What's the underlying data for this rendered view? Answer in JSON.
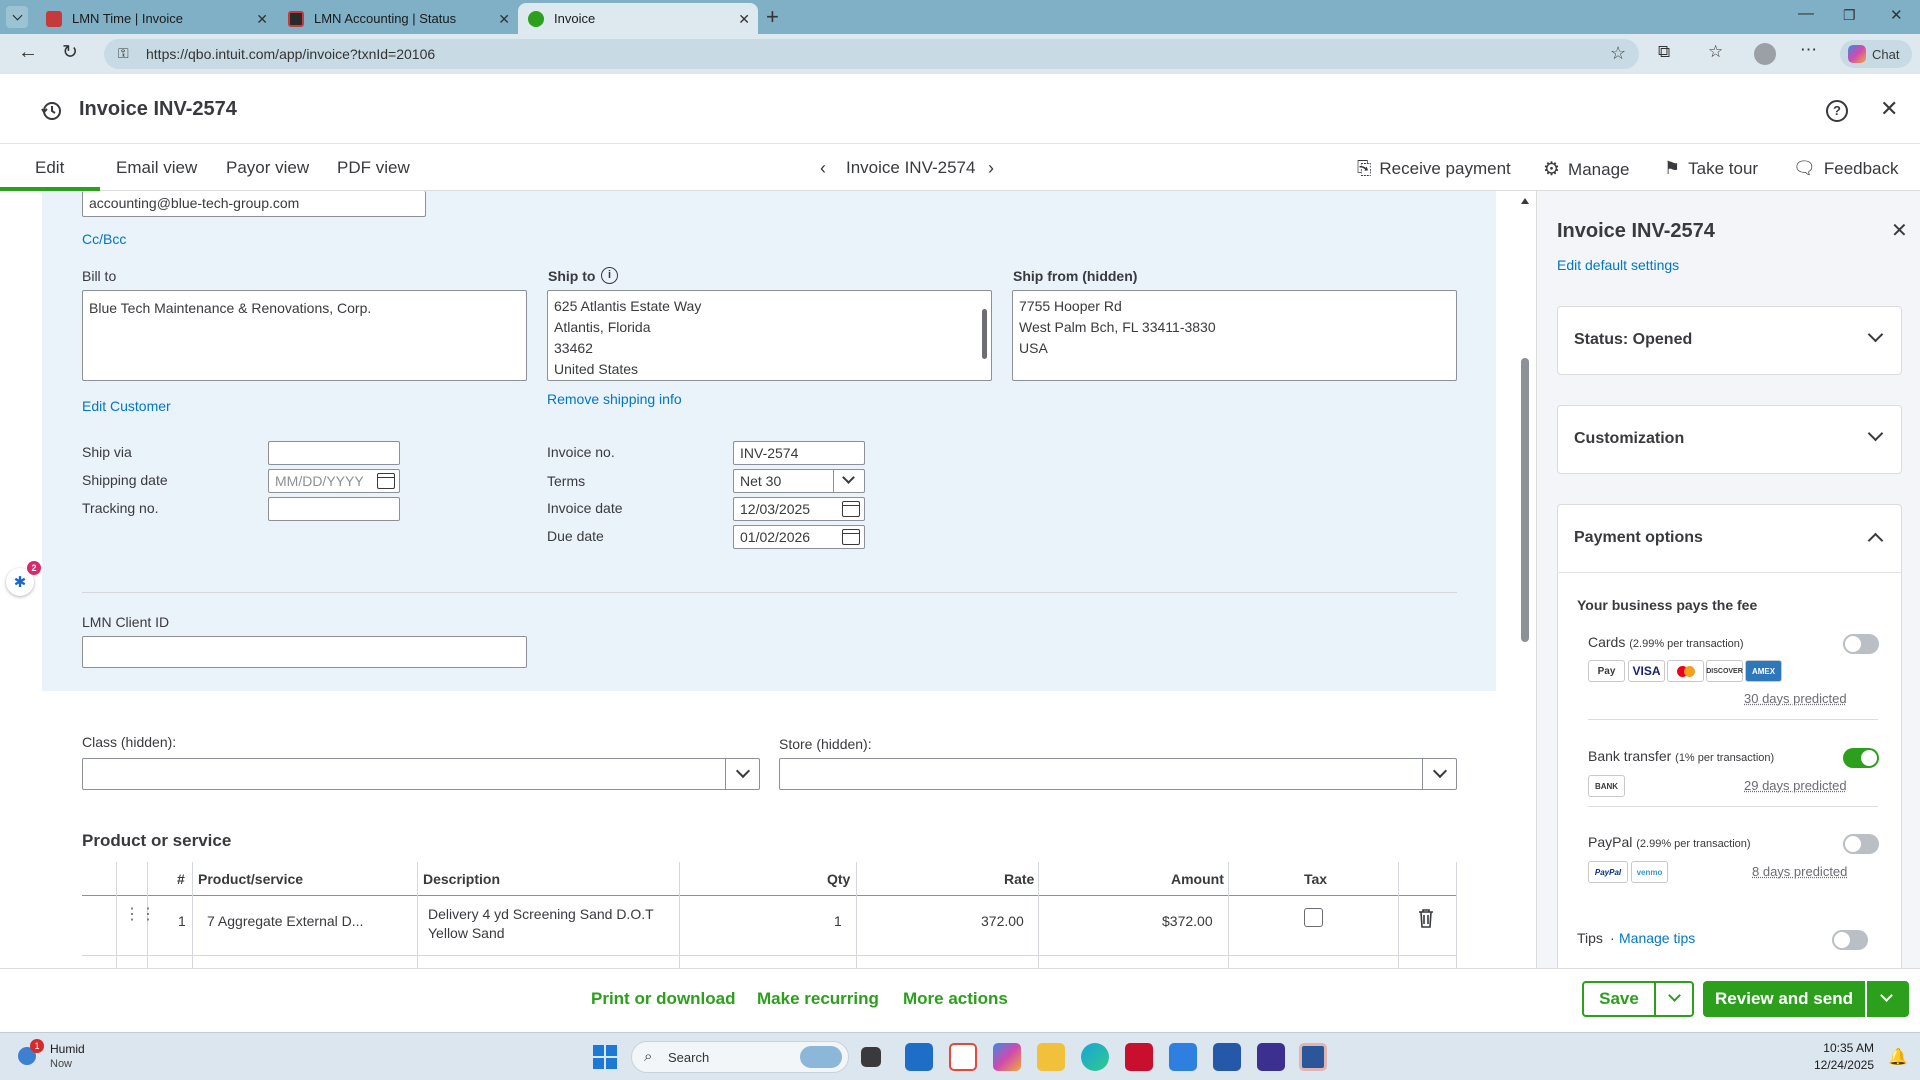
{
  "browser": {
    "tabs": [
      {
        "label": "LMN Time | Invoice",
        "active": false
      },
      {
        "label": "LMN Accounting | Status",
        "active": false
      },
      {
        "label": "Invoice",
        "active": true
      }
    ],
    "url": "https://qbo.intuit.com/app/invoice?txnId=20106",
    "chat_label": "Chat"
  },
  "header": {
    "title": "Invoice INV-2574"
  },
  "nav": {
    "tabs": [
      "Edit",
      "Email view",
      "Payor view",
      "PDF view"
    ],
    "center_title": "Invoice INV-2574",
    "actions": {
      "receive_payment": "Receive payment",
      "manage": "Manage",
      "take_tour": "Take tour",
      "feedback": "Feedback"
    }
  },
  "form": {
    "email_value": "accounting@blue-tech-group.com",
    "cc_bcc": "Cc/Bcc",
    "bill_to_label": "Bill to",
    "bill_to_value": "Blue Tech Maintenance & Renovations, Corp.",
    "ship_to_label": "Ship to",
    "ship_to_lines": [
      "625 Atlantis Estate Way",
      "Atlantis, Florida",
      "33462",
      "United States"
    ],
    "ship_from_label": "Ship from (hidden)",
    "ship_from_lines": [
      "7755 Hooper Rd",
      "West Palm Bch, FL  33411-3830",
      "USA"
    ],
    "edit_customer": "Edit Customer",
    "remove_shipping": "Remove shipping info",
    "ship_via_label": "Ship via",
    "ship_via_value": "",
    "shipping_date_label": "Shipping date",
    "shipping_date_placeholder": "MM/DD/YYYY",
    "tracking_label": "Tracking no.",
    "tracking_value": "",
    "invoice_no_label": "Invoice no.",
    "invoice_no_value": "INV-2574",
    "terms_label": "Terms",
    "terms_value": "Net 30",
    "invoice_date_label": "Invoice date",
    "invoice_date_value": "12/03/2025",
    "due_date_label": "Due date",
    "due_date_value": "01/02/2026",
    "lmn_client_id_label": "LMN Client ID",
    "lmn_client_id_value": "",
    "class_label": "Class (hidden):",
    "store_label": "Store (hidden):",
    "notification_count": "2"
  },
  "products": {
    "section_title": "Product or service",
    "columns": [
      "#",
      "Product/service",
      "Description",
      "Qty",
      "Rate",
      "Amount",
      "Tax"
    ],
    "rows": [
      {
        "num": "1",
        "product": "7 Aggregate External D...",
        "description_line1": "Delivery 4 yd Screening Sand D.O.T",
        "description_line2": "Yellow Sand",
        "qty": "1",
        "rate": "372.00",
        "amount": "$372.00",
        "tax": false
      }
    ]
  },
  "side_panel": {
    "title": "Invoice INV-2574",
    "edit_defaults": "Edit default settings",
    "status": "Status: Opened",
    "customization": "Customization",
    "payment_options": "Payment options",
    "fee_note": "Your business pays the fee",
    "cards_label": "Cards",
    "cards_fee": "(2.99% per transaction)",
    "cards_enabled": false,
    "cards_logos": [
      "Pay",
      "VISA",
      "",
      "DISCOVER",
      "AMEX"
    ],
    "cards_predicted": "30 days predicted",
    "bank_label": "Bank transfer",
    "bank_fee": "(1% per transaction)",
    "bank_enabled": true,
    "bank_logo": "BANK",
    "bank_predicted": "29 days predicted",
    "paypal_label": "PayPal",
    "paypal_fee": "(2.99% per transaction)",
    "paypal_enabled": false,
    "paypal_logos": [
      "PayPal",
      "venmo"
    ],
    "paypal_predicted": "8 days predicted",
    "tips_label": "Tips",
    "manage_tips": "Manage tips",
    "tips_enabled": false
  },
  "footer": {
    "print": "Print or download",
    "recurring": "Make recurring",
    "more": "More actions",
    "save": "Save",
    "review_send": "Review and send"
  },
  "taskbar": {
    "weather_title": "Humid",
    "weather_sub": "Now",
    "weather_badge": "1",
    "search_placeholder": "Search",
    "time": "10:35 AM",
    "date": "12/24/2025"
  },
  "colors": {
    "accent_green": "#2ca01c",
    "link_blue": "#0077c5",
    "panel_blue": "#eaf2fa",
    "tabbar": "#7fb0c6"
  }
}
